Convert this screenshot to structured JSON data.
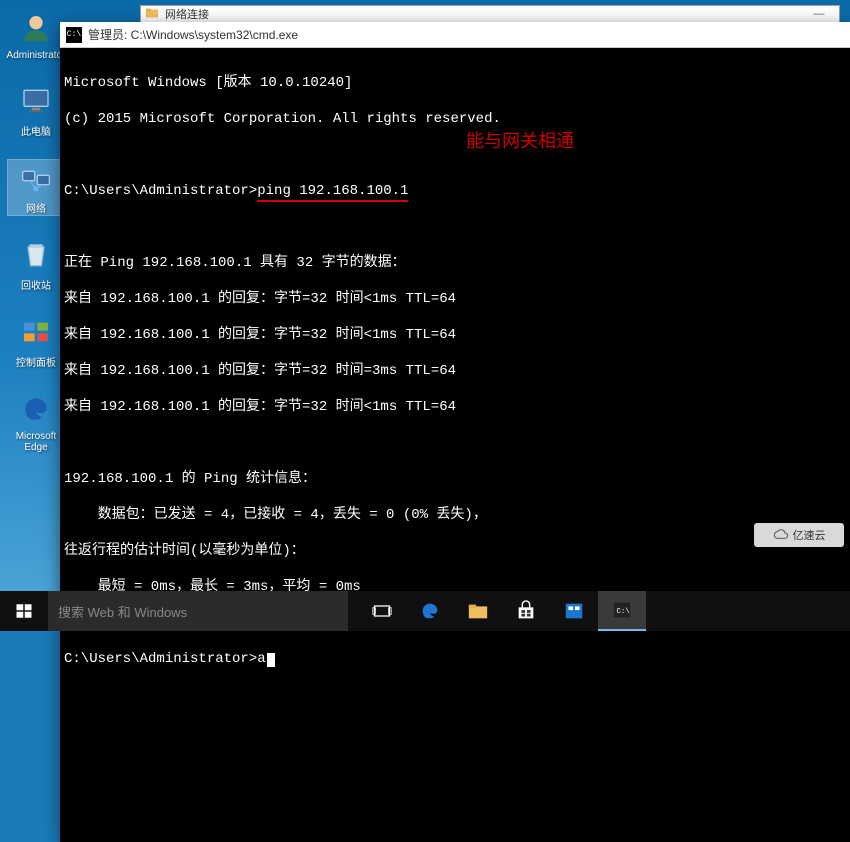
{
  "desktop": {
    "icons": [
      {
        "name": "administrator",
        "label": "Administrator",
        "glyph": "user"
      },
      {
        "name": "this-pc",
        "label": "此电脑",
        "glyph": "monitor"
      },
      {
        "name": "network",
        "label": "网络",
        "glyph": "network",
        "selected": true
      },
      {
        "name": "recycle-bin",
        "label": "回收站",
        "glyph": "bin"
      },
      {
        "name": "control-panel",
        "label": "控制面板",
        "glyph": "panel"
      },
      {
        "name": "edge",
        "label": "Microsoft Edge",
        "glyph": "edge"
      }
    ]
  },
  "netconn_window": {
    "title": "网络连接",
    "minimize": "—"
  },
  "cmd": {
    "title": "管理员: C:\\Windows\\system32\\cmd.exe",
    "version_line": "Microsoft Windows [版本 10.0.10240]",
    "copyright_line": "(c) 2015 Microsoft Corporation. All rights reserved.",
    "prompt1_prefix": "C:\\Users\\Administrator>",
    "prompt1_cmd": "ping 192.168.100.1",
    "ping_header": "正在 Ping 192.168.100.1 具有 32 字节的数据：",
    "replies": [
      "来自 192.168.100.1 的回复：字节=32 时间<1ms TTL=64",
      "来自 192.168.100.1 的回复：字节=32 时间<1ms TTL=64",
      "来自 192.168.100.1 的回复：字节=32 时间=3ms TTL=64",
      "来自 192.168.100.1 的回复：字节=32 时间<1ms TTL=64"
    ],
    "stats_header": "192.168.100.1 的 Ping 统计信息：",
    "stats_packets": "    数据包：已发送 = 4，已接收 = 4，丢失 = 0 (0% 丢失)，",
    "stats_rtt_header": "往返行程的估计时间(以毫秒为单位)：",
    "stats_rtt": "    最短 = 0ms，最长 = 3ms，平均 = 0ms",
    "prompt2_prefix": "C:\\Users\\Administrator>",
    "prompt2_input": "a",
    "annotation": "能与网关相通"
  },
  "taskbar": {
    "search_placeholder": "搜索 Web 和 Windows",
    "items": [
      {
        "name": "task-view",
        "glyph": "taskview"
      },
      {
        "name": "edge",
        "glyph": "edge"
      },
      {
        "name": "file-explorer",
        "glyph": "folder"
      },
      {
        "name": "store",
        "glyph": "store"
      },
      {
        "name": "settings-app",
        "glyph": "settings"
      },
      {
        "name": "cmd-running",
        "glyph": "cmd",
        "active": true
      }
    ]
  },
  "watermark": {
    "text": "亿速云"
  }
}
